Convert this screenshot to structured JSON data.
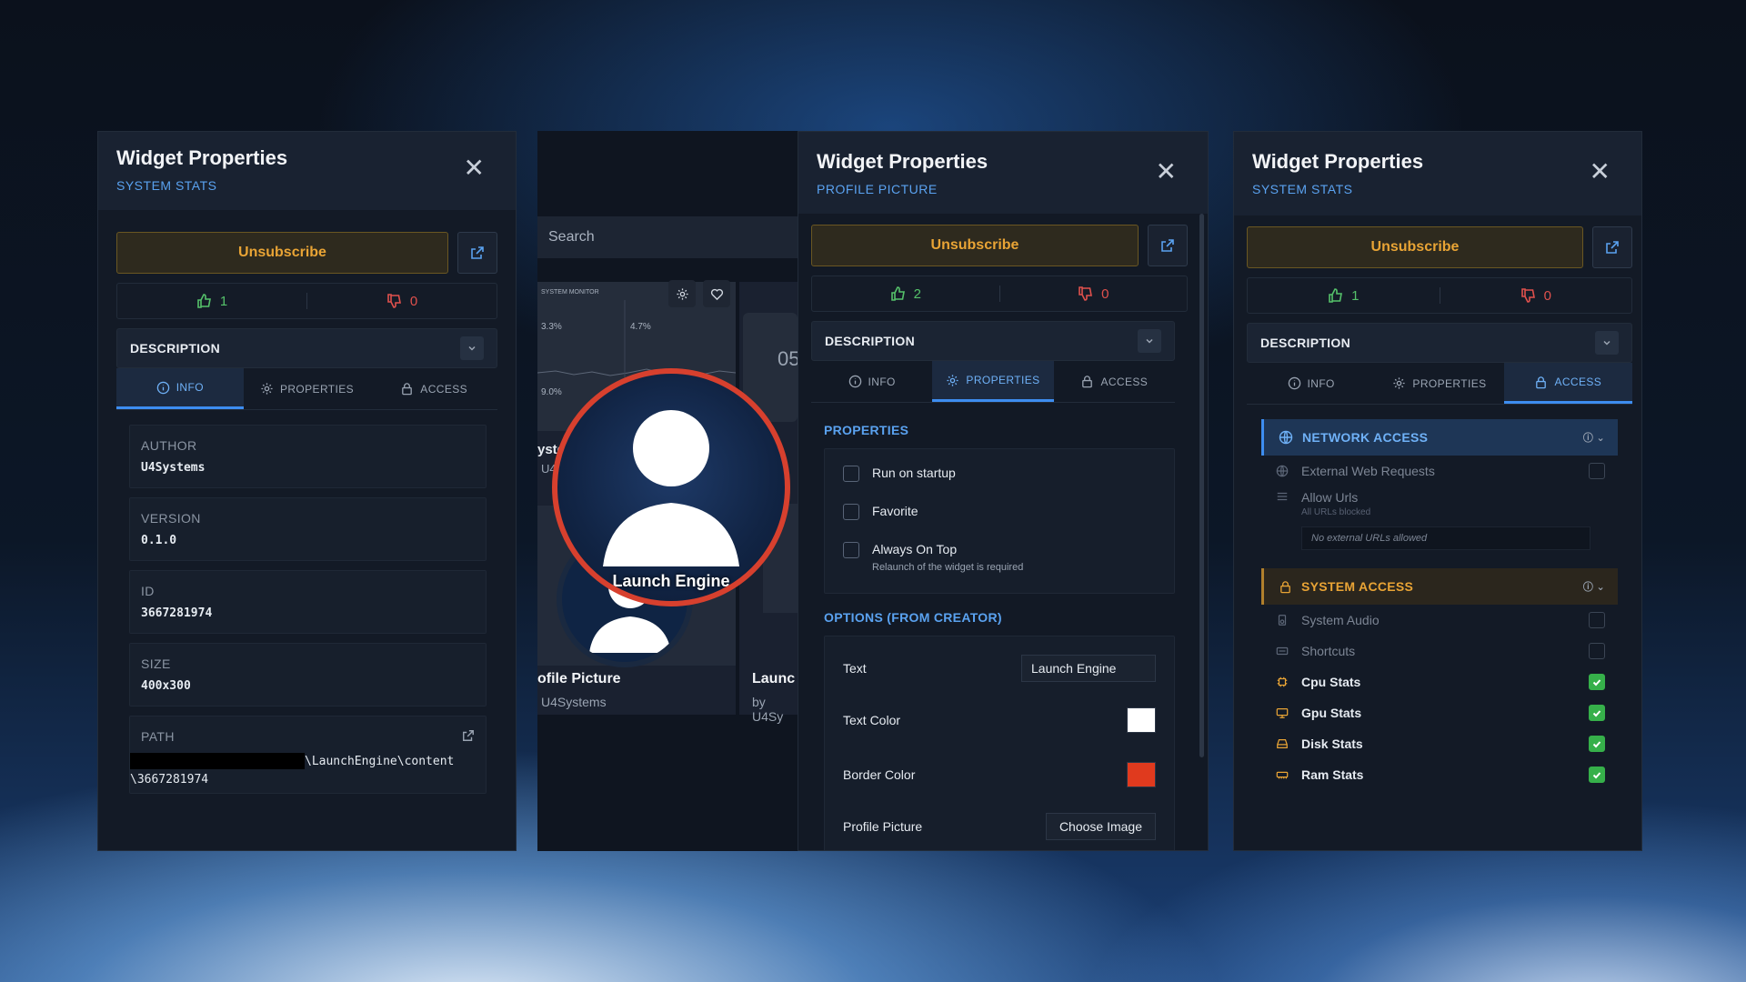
{
  "panels": {
    "left": {
      "title": "Widget Properties",
      "subtitle": "SYSTEM STATS",
      "unsubscribe": "Unsubscribe",
      "likes": "1",
      "dislikes": "0",
      "description_label": "DESCRIPTION",
      "tabs": [
        "INFO",
        "PROPERTIES",
        "ACCESS"
      ],
      "info": [
        {
          "key": "AUTHOR",
          "value": "U4Systems"
        },
        {
          "key": "VERSION",
          "value": "0.1.0"
        },
        {
          "key": "ID",
          "value": "3667281974"
        },
        {
          "key": "SIZE",
          "value": "400x300"
        }
      ],
      "path_label": "PATH",
      "path_line1": "\\LaunchEngine\\content",
      "path_line2": "\\3667281974"
    },
    "middle": {
      "title": "Widget Properties",
      "subtitle": "PROFILE PICTURE",
      "unsubscribe": "Unsubscribe",
      "likes": "2",
      "dislikes": "0",
      "description_label": "DESCRIPTION",
      "tabs": [
        "INFO",
        "PROPERTIES",
        "ACCESS"
      ],
      "properties_label": "PROPERTIES",
      "checks": [
        {
          "label": "Run on startup",
          "sub": ""
        },
        {
          "label": "Favorite",
          "sub": ""
        },
        {
          "label": "Always On Top",
          "sub": "Relaunch of the widget is required"
        }
      ],
      "options_label": "OPTIONS (FROM CREATOR)",
      "options": {
        "text_label": "Text",
        "text_value": "Launch Engine",
        "text_color_label": "Text Color",
        "text_color": "#ffffff",
        "border_color_label": "Border Color",
        "border_color": "#e03a1e",
        "profile_picture_label": "Profile Picture",
        "choose_image": "Choose Image"
      }
    },
    "right": {
      "title": "Widget Properties",
      "subtitle": "SYSTEM STATS",
      "unsubscribe": "Unsubscribe",
      "likes": "1",
      "dislikes": "0",
      "description_label": "DESCRIPTION",
      "tabs": [
        "INFO",
        "PROPERTIES",
        "ACCESS"
      ],
      "network_access": "NETWORK ACCESS",
      "external_web_requests": "External Web Requests",
      "allow_urls": "Allow Urls",
      "allow_urls_sub": "All URLs blocked",
      "no_urls": "No external URLs allowed",
      "system_access": "SYSTEM ACCESS",
      "system_items": [
        {
          "label": "System Audio",
          "checked": false,
          "enabled": false
        },
        {
          "label": "Shortcuts",
          "checked": false,
          "enabled": false
        },
        {
          "label": "Cpu Stats",
          "checked": true,
          "enabled": true
        },
        {
          "label": "Gpu Stats",
          "checked": true,
          "enabled": true
        },
        {
          "label": "Disk Stats",
          "checked": true,
          "enabled": true
        },
        {
          "label": "Ram Stats",
          "checked": true,
          "enabled": true
        }
      ]
    }
  },
  "preview": {
    "search_placeholder": "Search",
    "avatar_label": "Launch Engine",
    "card1_title": "ofile Picture",
    "card1_author": "U4Systems",
    "card2_title": "Launc",
    "card2_author": "by U4Sy",
    "thumb_header": "SYSTEM MONITOR",
    "thumb_values": [
      "3.3%",
      "4.7%",
      "9.0%"
    ],
    "partial_title": "yste",
    "partial_author": "U4",
    "clock_partial": "05"
  },
  "colors": {
    "accent": "#3d8df0",
    "unsubscribe": "#e9a435",
    "like": "#55c16a",
    "dislike": "#e0514d",
    "network_header": "#1e3656",
    "system_header": "#2b261d"
  }
}
